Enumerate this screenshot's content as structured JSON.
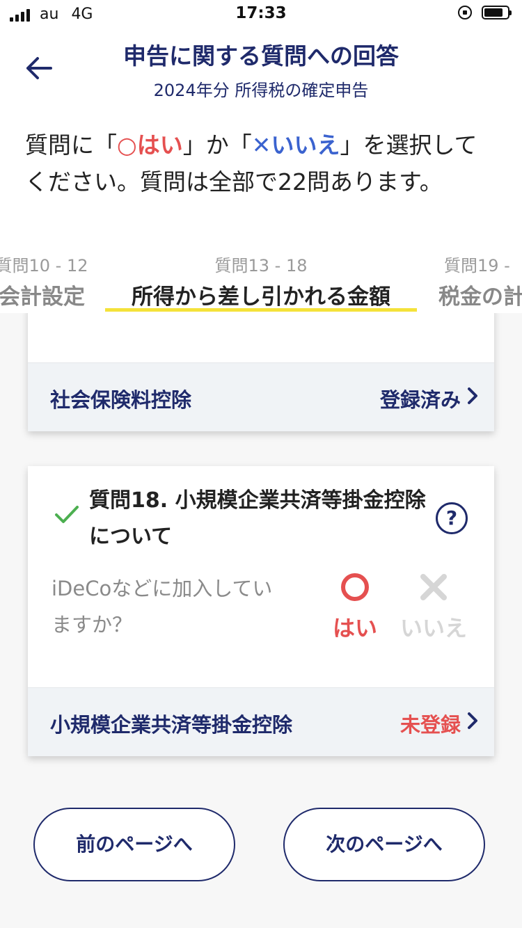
{
  "status_bar": {
    "carrier": "au",
    "network": "4G",
    "time": "17:33"
  },
  "header": {
    "title": "申告に関する質問への回答",
    "subtitle": "2024年分 所得税の確定申告"
  },
  "intro": {
    "part1": "質問に「",
    "maru_symbol": "○",
    "maru_text": "はい",
    "part2": "」か「",
    "batsu_symbol": "✕",
    "batsu_text": "いいえ",
    "part3": "」を選択してください。質問は全部で22問あります。"
  },
  "tabs": [
    {
      "range": "質問10 - 12",
      "name": "会計設定"
    },
    {
      "range": "質問13 - 18",
      "name": "所得から差し引かれる金額"
    },
    {
      "range": "質問19 -",
      "name": "税金の計"
    }
  ],
  "cards": {
    "social_insurance": {
      "label": "社会保険料控除",
      "status": "登録済み"
    },
    "question18": {
      "title": "質問18. 小規模企業共済等掛金控除について",
      "question": "iDeCoなどに加入していますか？",
      "yes_label": "はい",
      "no_label": "いいえ",
      "footer_label": "小規模企業共済等掛金控除",
      "footer_status": "未登録"
    }
  },
  "nav": {
    "prev": "前のページへ",
    "next": "次のページへ"
  },
  "colors": {
    "navy": "#1f2a6b",
    "red": "#e55050",
    "blue": "#3b63cf",
    "yellow": "#f4e23a",
    "green": "#4caf50"
  }
}
